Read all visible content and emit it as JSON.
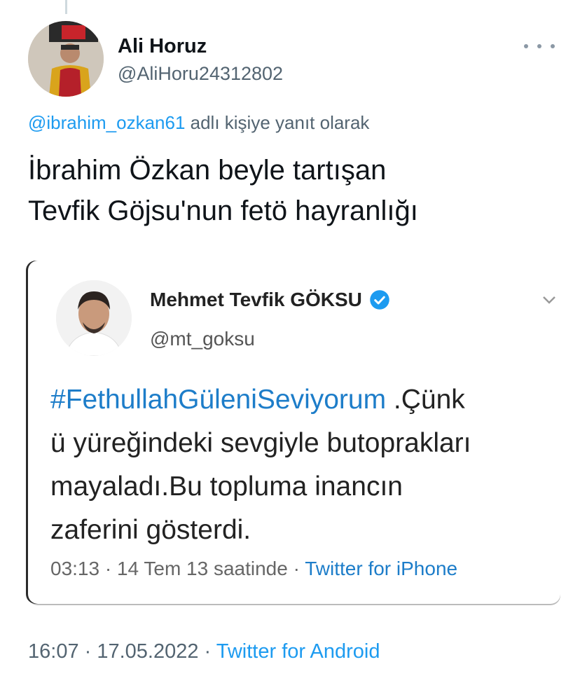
{
  "author": {
    "name": "Ali Horuz",
    "handle": "@AliHoru24312802"
  },
  "reply": {
    "mention": "@ibrahim_ozkan61",
    "suffix": "adlı kişiye yanıt olarak"
  },
  "tweet": {
    "lines": [
      "İbrahim Özkan beyle tartışan",
      "Tevfik Göjsu'nun fetö hayranlığı"
    ]
  },
  "embedded": {
    "name": "Mehmet Tevfik GÖKSU",
    "handle": "@mt_goksu",
    "hashtag": "#FethullahGüleniSeviyorum",
    "line1_rest": " .Çünk",
    "lines": [
      "ü yüreğindeki sevgiyle butoprakları",
      "mayaladı.Bu topluma inancın",
      "zaferini gösterdi."
    ],
    "meta_time": "03:13 · 14 Tem 13 saatinde · ",
    "meta_source": "Twitter for iPhone"
  },
  "footer": {
    "time": "16:07 · 17.05.2022 · ",
    "source": "Twitter for Android"
  },
  "colors": {
    "link": "#1d9bf0",
    "verified": "#1d9bf0"
  }
}
